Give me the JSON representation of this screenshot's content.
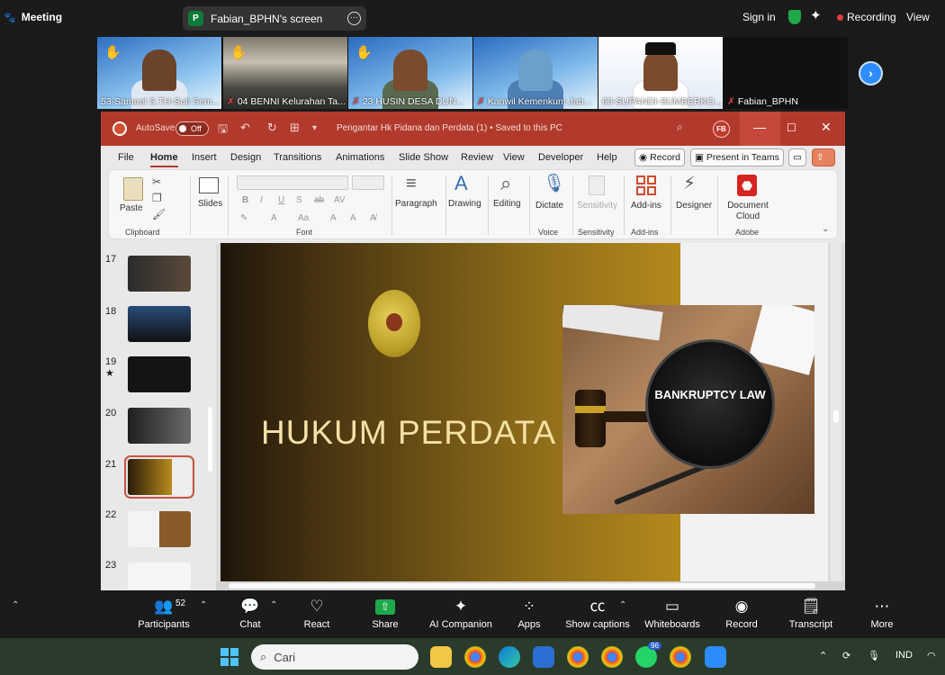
{
  "zoom_topbar": {
    "meeting_label": "Meeting",
    "screen_share_label": "Fabian_BPHN's screen",
    "screen_share_badge": "P",
    "sign_in": "Sign in",
    "recording": "Recording",
    "view": "View"
  },
  "participants_strip": [
    {
      "name": "53-Samuel S.TH-Suti Sem...",
      "muted": false
    },
    {
      "name": "04 BENNI Kelurahan Ta...",
      "muted": true
    },
    {
      "name": "23 HUSIN DESA DUN...",
      "muted": true
    },
    {
      "name": "Kanwil Kemenkum Jab...",
      "muted": true
    },
    {
      "name": "60-SUPANDI-SUMBERKO...",
      "muted": false
    },
    {
      "name": "Fabian_BPHN",
      "muted": true
    }
  ],
  "powerpoint": {
    "autosave_label": "AutoSave",
    "autosave_state": "Off",
    "document_title": "Pengantar Hk Pidana dan Perdata (1)  •  Saved to this PC",
    "user_initials": "FB",
    "menu": [
      "File",
      "Home",
      "Insert",
      "Design",
      "Transitions",
      "Animations",
      "Slide Show",
      "Review",
      "View",
      "Developer",
      "Help"
    ],
    "active_menu": "Home",
    "record_button": "Record",
    "present_teams_button": "Present in Teams",
    "ribbon": {
      "paste": "Paste",
      "slides": "Slides",
      "paragraph": "Paragraph",
      "drawing": "Drawing",
      "editing": "Editing",
      "dictate": "Dictate",
      "sensitivity": "Sensitivity",
      "addins": "Add-ins",
      "designer": "Designer",
      "document_cloud": "Document Cloud",
      "groups": {
        "clipboard": "Clipboard",
        "font": "Font",
        "voice": "Voice",
        "sensitivity": "Sensitivity",
        "addins": "Add-ins",
        "adobe": "Adobe"
      }
    },
    "slide_numbers": [
      "17",
      "18",
      "19",
      "20",
      "21",
      "22",
      "23"
    ],
    "selected_slide": "21",
    "current_slide": {
      "title": "HUKUM PERDATA",
      "image_text": "BANKRUPTCY LAW"
    }
  },
  "zoom_toolbar": {
    "participants": "Participants",
    "participant_count": "52",
    "chat": "Chat",
    "react": "React",
    "share": "Share",
    "ai_companion": "AI Companion",
    "apps": "Apps",
    "show_captions": "Show captions",
    "whiteboards": "Whiteboards",
    "record": "Record",
    "transcript": "Transcript",
    "more": "More"
  },
  "taskbar": {
    "search_placeholder": "Cari",
    "whatsapp_badge": "96",
    "language": "IND"
  },
  "colors": {
    "ppt_red": "#b23a2c",
    "zoom_green": "#1fa84a",
    "zoom_blue": "#2d8cff",
    "slide_gold": "#bf931f"
  }
}
